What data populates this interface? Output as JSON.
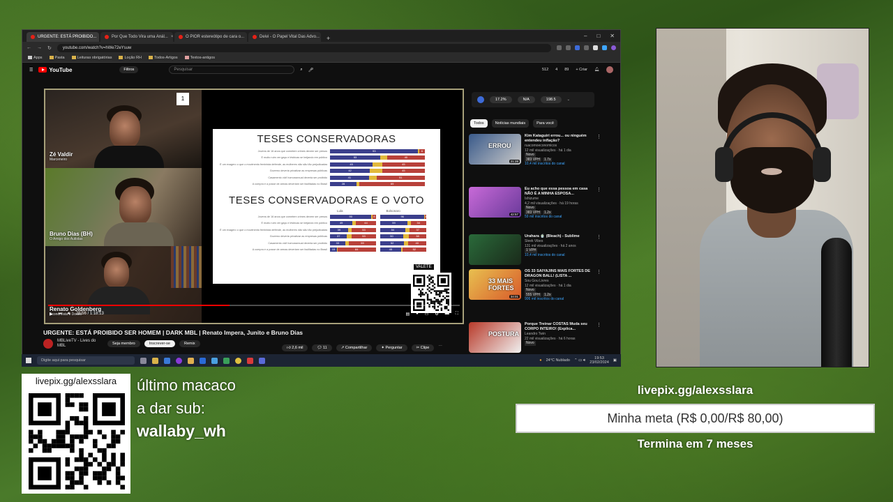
{
  "browser": {
    "tabs": [
      {
        "label": "URGENTE: ESTÁ PROIBIDO...",
        "active": true
      },
      {
        "label": "Por Que Todo Vira uma Anál..."
      },
      {
        "label": "O PIOR estereótipo de cara o..."
      },
      {
        "label": "Deivi - O Papel Vital Das Advo..."
      }
    ],
    "url": "youtube.com/watch?v=hWe72eYsuw",
    "bookmarks": [
      "Apps",
      "Pasta",
      "Leituras obrigatórias",
      "Loção RH",
      "Todos-Artigos",
      "Textos-antigos"
    ]
  },
  "youtube": {
    "logo": "YouTube",
    "filters_label": "Filtros",
    "search_placeholder": "Pesquisar",
    "header_stats": [
      "512",
      "4",
      "89"
    ],
    "create_label": "Criar",
    "video_title": "URGENTE: ESTÁ PROIBIDO SER HOMEM | DARK MBL | Renato Impera, Junito e Bruno Dias",
    "channel": {
      "name": "MBLiveTV - Lives do MBL",
      "join": "Seja membro",
      "subscribe": "Inscrever-se",
      "remix": "Remix"
    },
    "actions": {
      "likes": "2,6 mil",
      "comments": "11",
      "share": "Compartilhar",
      "ask": "Perguntar",
      "clip": "Clipe"
    },
    "player": {
      "time": "23:56 / 1:18:13",
      "progress_pct": 44,
      "qr_tag": "VALETE",
      "cams": [
        {
          "name": "Zé Valdir",
          "role": "Marceneiro"
        },
        {
          "name": "Bruno Dias (BH)",
          "role": "O Amigo dos Autistas"
        },
        {
          "name": "Renato Goldenberg",
          "role": "Economista e Doutor"
        }
      ],
      "slide": {
        "title1": "TESES CONSERVADORAS",
        "rows1": [
          {
            "label": "Jovens de 16 anos que cometem crimes devem ser presos",
            "values": [
              93,
              6
            ]
          },
          {
            "label": "É muito ruim ver gays e lésbicas se beijando em público",
            "values": [
              53,
              40
            ]
          },
          {
            "label": "É um exagero o que o movimento feminista defende, as mulheres não são tão prejudicadas",
            "values": [
              45,
              45
            ]
          },
          {
            "label": "Governo deveria privatizar as empresas públicas",
            "values": [
              42,
              45
            ]
          },
          {
            "label": "Casamento civil homossexual deveria ser proibido",
            "values": [
              41,
              51
            ]
          },
          {
            "label": "A compra e a posse de armas deveriam ser facilitadas no Brasil",
            "values": [
              28,
              69
            ]
          }
        ],
        "title2": "TESES CONSERVADORAS E O VOTO",
        "col_a": "Lula",
        "col_b": "Bolsonaro",
        "rows2": [
          {
            "label": "Jovens de 16 anos que cometem crimes devem ser presos",
            "a": [
              90,
              8
            ],
            "b": [
              96,
              3
            ]
          },
          {
            "label": "É muito ruim ver gays e lésbicas se beijando em público",
            "a": [
              49,
              44
            ],
            "b": [
              59,
              34
            ]
          },
          {
            "label": "É um exagero o que o movimento feminista defende, as mulheres não são tão prejudicadas",
            "a": [
              39,
              53
            ],
            "b": [
              54,
              37
            ]
          },
          {
            "label": "Governo deveria privatizar as empresas públicas",
            "a": [
              37,
              53
            ],
            "b": [
              50,
              38
            ]
          },
          {
            "label": "Casamento civil homossexual deveria ser proibido",
            "a": [
              33,
              59
            ],
            "b": [
              52,
              40
            ]
          },
          {
            "label": "A compra e a posse de armas deveriam ser facilitadas no Brasil",
            "a": [
              15,
              84
            ],
            "b": [
              45,
              52
            ]
          }
        ]
      }
    },
    "stats_bar": [
      "17.2%",
      "N/A",
      "198.5"
    ],
    "chips": [
      "Todos",
      "Notícias mundiais",
      "Para você"
    ],
    "recommendations": [
      {
        "title": "Kim Kataguiri errou... ou ninguém entendeu inflação?",
        "channel": "ruacomoeconomicos",
        "meta": "12 mil visualizações · há 1 dia",
        "badge": "Novo",
        "tags": [
          "383 VPH",
          "1.7x"
        ],
        "subs": "10,4 mil inscritos do canal",
        "duration": "21:28",
        "thumb_text": "ERROU",
        "c1": "#3a5a8a",
        "c2": "#c8c8c8"
      },
      {
        "title": "Eu acho que essa pessoa em casa NÃO É A MINHA ESPOSA...",
        "channel": "Ishizume",
        "meta": "4,2 mil visualizações · há 19 horas",
        "badge": "Novo",
        "tags": [
          "383 VPH",
          "1.2x"
        ],
        "subs": "59 mil inscritos do canal",
        "duration": "42:57",
        "thumb_text": "",
        "c1": "#c86ad8",
        "c2": "#6a3a9a"
      },
      {
        "title": "Urahara 🍵 (Bleach) - Sublime",
        "channel": "Sleek Vibes",
        "meta": "131 mil visualizações · há 2 anos",
        "badge": "",
        "tags": [
          "1 VPH"
        ],
        "subs": "10,4 mil inscritos do canal",
        "duration": "",
        "thumb_text": "",
        "c1": "#2a6a3a",
        "c2": "#1a2a1a"
      },
      {
        "title": "OS 33 SAIYAJINS MAIS FORTES DE DRAGON BALL! (LISTA ...",
        "channel": "Sou Gou Livres",
        "meta": "12 mil visualizações · há 1 dia",
        "badge": "Novo",
        "tags": [
          "555 VPH",
          "1.2x"
        ],
        "subs": "906 mil inscritos do canal",
        "duration": "34:01",
        "thumb_text": "33 MAIS FORTES",
        "c1": "#e8c050",
        "c2": "#d85a2a"
      },
      {
        "title": "Porque Treinar COSTAS Muda seu CORPO INTEIRO! (Explica...",
        "channel": "Leandro Twin",
        "meta": "22 mil visualizações · há 6 horas",
        "badge": "Novo",
        "tags": [],
        "subs": "",
        "duration": "",
        "thumb_text": "POSTURA",
        "c1": "#b83a2a",
        "c2": "#f0f0f0"
      }
    ]
  },
  "taskbar": {
    "search_placeholder": "Digite aqui para pesquisar",
    "weather": "24°C Nublado",
    "time": "19:53",
    "date": "23/02/2024"
  },
  "overlay": {
    "qr_link": "livepix.gg/alexsslara",
    "sub_line1": "último macaco",
    "sub_line2": "a dar sub:",
    "sub_user": "wallaby_wh",
    "goal_link": "livepix.gg/alexsslara",
    "goal_text": "Minha meta (R$ 0,00/R$ 80,00)",
    "goal_ends": "Termina em 7 meses"
  }
}
